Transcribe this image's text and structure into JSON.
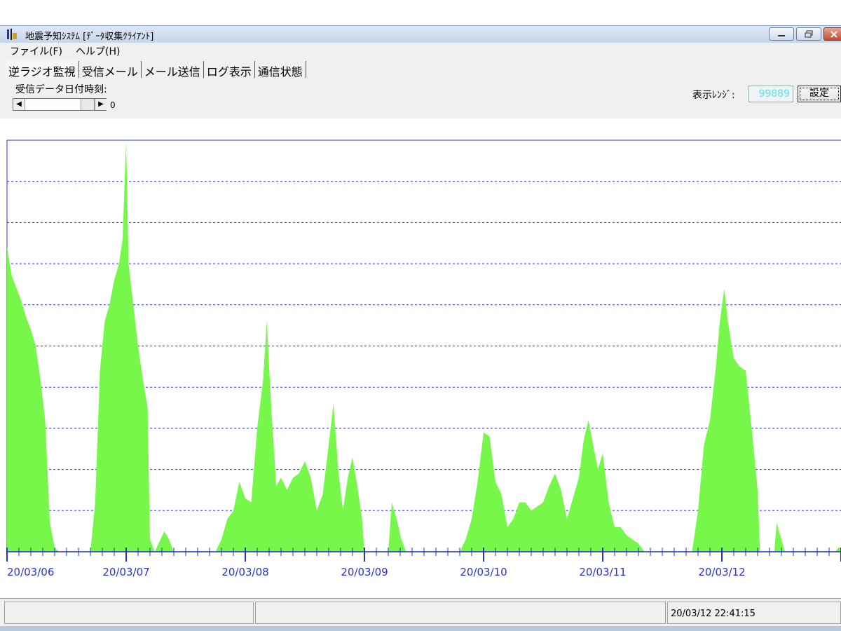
{
  "window": {
    "title": "地震予知ｼｽﾃﾑ [ﾃﾞｰﾀ収集ｸﾗｲｱﾝﾄ]"
  },
  "menu": {
    "items": [
      "ファイル(F)",
      "ヘルプ(H)"
    ]
  },
  "tabs": [
    "逆ラジオ監視",
    "受信メール",
    "メール送信",
    "ログ表示",
    "通信状態"
  ],
  "active_tab": "逆ラジオ監視",
  "receive_label": "受信データ日付時刻:",
  "scroll_value": "0",
  "range": {
    "label": "表示ﾚﾝｼﾞ:",
    "value": "99889"
  },
  "set_button": "設定",
  "status": {
    "left": "",
    "middle": "",
    "datetime": "20/03/12 22:41:15"
  },
  "colors": {
    "fill": "#77f74a",
    "grid": "#2b34c9",
    "axis": "#2b34c9"
  },
  "chart_data": {
    "type": "area",
    "x_tick_labels": [
      "20/03/06",
      "20/03/07",
      "20/03/08",
      "20/03/09",
      "20/03/10",
      "20/03/11",
      "20/03/12"
    ],
    "ylim": [
      0,
      10
    ],
    "grid": "dashed horizontal",
    "profile": [
      [
        0.0,
        7.4
      ],
      [
        0.04,
        6.7
      ],
      [
        0.08,
        6.4
      ],
      [
        0.12,
        6.1
      ],
      [
        0.16,
        5.7
      ],
      [
        0.2,
        5.4
      ],
      [
        0.24,
        5.0
      ],
      [
        0.28,
        4.2
      ],
      [
        0.32,
        3.2
      ],
      [
        0.36,
        0.7
      ],
      [
        0.4,
        0.1
      ],
      [
        0.44,
        0.0
      ],
      [
        0.7,
        0.0
      ],
      [
        0.74,
        1.2
      ],
      [
        0.78,
        4.4
      ],
      [
        0.82,
        5.6
      ],
      [
        0.86,
        6.0
      ],
      [
        0.9,
        6.6
      ],
      [
        0.94,
        7.0
      ],
      [
        0.97,
        7.6
      ],
      [
        1.0,
        10.0
      ],
      [
        1.02,
        7.0
      ],
      [
        1.06,
        6.0
      ],
      [
        1.1,
        5.0
      ],
      [
        1.14,
        4.2
      ],
      [
        1.18,
        3.5
      ],
      [
        1.2,
        0.3
      ],
      [
        1.24,
        0.0
      ],
      [
        1.32,
        0.5
      ],
      [
        1.36,
        0.3
      ],
      [
        1.4,
        0.0
      ],
      [
        1.75,
        0.0
      ],
      [
        1.8,
        0.3
      ],
      [
        1.85,
        0.8
      ],
      [
        1.9,
        1.0
      ],
      [
        1.95,
        1.7
      ],
      [
        2.0,
        1.3
      ],
      [
        2.05,
        1.2
      ],
      [
        2.1,
        3.0
      ],
      [
        2.15,
        4.2
      ],
      [
        2.18,
        5.6
      ],
      [
        2.22,
        3.4
      ],
      [
        2.26,
        1.6
      ],
      [
        2.3,
        1.8
      ],
      [
        2.35,
        1.5
      ],
      [
        2.4,
        1.8
      ],
      [
        2.45,
        1.9
      ],
      [
        2.5,
        2.2
      ],
      [
        2.55,
        1.8
      ],
      [
        2.6,
        1.0
      ],
      [
        2.65,
        1.4
      ],
      [
        2.7,
        2.6
      ],
      [
        2.74,
        3.6
      ],
      [
        2.78,
        2.0
      ],
      [
        2.82,
        1.0
      ],
      [
        2.86,
        1.8
      ],
      [
        2.9,
        2.3
      ],
      [
        2.94,
        1.6
      ],
      [
        2.98,
        0.8
      ],
      [
        3.0,
        0.0
      ],
      [
        3.2,
        0.0
      ],
      [
        3.23,
        1.2
      ],
      [
        3.27,
        0.8
      ],
      [
        3.31,
        0.3
      ],
      [
        3.35,
        0.0
      ],
      [
        3.8,
        0.0
      ],
      [
        3.85,
        0.3
      ],
      [
        3.9,
        0.8
      ],
      [
        3.95,
        1.7
      ],
      [
        4.0,
        2.9
      ],
      [
        4.05,
        2.8
      ],
      [
        4.1,
        1.7
      ],
      [
        4.15,
        1.4
      ],
      [
        4.2,
        0.6
      ],
      [
        4.25,
        0.8
      ],
      [
        4.3,
        1.2
      ],
      [
        4.35,
        1.2
      ],
      [
        4.4,
        1.0
      ],
      [
        4.45,
        1.1
      ],
      [
        4.5,
        1.2
      ],
      [
        4.55,
        1.6
      ],
      [
        4.6,
        1.9
      ],
      [
        4.65,
        1.5
      ],
      [
        4.7,
        0.8
      ],
      [
        4.75,
        1.3
      ],
      [
        4.8,
        1.8
      ],
      [
        4.84,
        2.7
      ],
      [
        4.88,
        3.2
      ],
      [
        4.92,
        2.6
      ],
      [
        4.96,
        2.0
      ],
      [
        5.0,
        2.4
      ],
      [
        5.05,
        1.2
      ],
      [
        5.1,
        0.6
      ],
      [
        5.15,
        0.6
      ],
      [
        5.2,
        0.4
      ],
      [
        5.25,
        0.3
      ],
      [
        5.3,
        0.2
      ],
      [
        5.35,
        0.0
      ],
      [
        5.75,
        0.0
      ],
      [
        5.8,
        1.0
      ],
      [
        5.85,
        2.6
      ],
      [
        5.9,
        3.2
      ],
      [
        5.95,
        4.5
      ],
      [
        5.98,
        5.5
      ],
      [
        6.02,
        6.4
      ],
      [
        6.05,
        5.6
      ],
      [
        6.1,
        4.7
      ],
      [
        6.15,
        4.5
      ],
      [
        6.2,
        4.4
      ],
      [
        6.25,
        3.0
      ],
      [
        6.3,
        1.5
      ],
      [
        6.32,
        0.0
      ],
      [
        6.44,
        0.0
      ],
      [
        6.46,
        0.7
      ],
      [
        6.5,
        0.3
      ],
      [
        6.53,
        0.0
      ],
      [
        6.95,
        0.0
      ],
      [
        6.98,
        0.1
      ],
      [
        7.02,
        0.1
      ],
      [
        7.05,
        0.0
      ],
      [
        7.07,
        0.0
      ],
      [
        7.1,
        5.0
      ]
    ]
  }
}
